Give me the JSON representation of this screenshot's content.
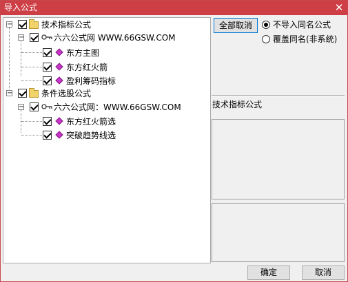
{
  "window": {
    "title": "导入公式",
    "close_glyph": "✕"
  },
  "tree": {
    "groups": [
      {
        "label": "技术指标公式",
        "source": "六六公式网 WWW.66GSW.COM",
        "items": [
          "东方主图",
          "东方红火箭",
          "盈利筹码指标"
        ]
      },
      {
        "label": "条件选股公式",
        "source": "六六公式网：WWW.66GSW.COM",
        "items": [
          "东方红火箭选",
          "突破趋势线选"
        ]
      }
    ]
  },
  "options": {
    "cancel_all_label": "全部取消",
    "radio_no_import_label": "不导入同名公式",
    "radio_overwrite_label": "覆盖同名(非系统)",
    "selected": "no_import"
  },
  "detail": {
    "section_title": "技术指标公式"
  },
  "footer": {
    "ok_label": "确定",
    "cancel_label": "取消"
  },
  "colors": {
    "title_bar": "#cd3f45",
    "folder": "#f1d36a",
    "formula_icon": "#cc33cc"
  },
  "icons": [
    "close-icon",
    "folder-icon",
    "key-icon",
    "formula-icon",
    "checkbox-icon",
    "expand-icon"
  ]
}
